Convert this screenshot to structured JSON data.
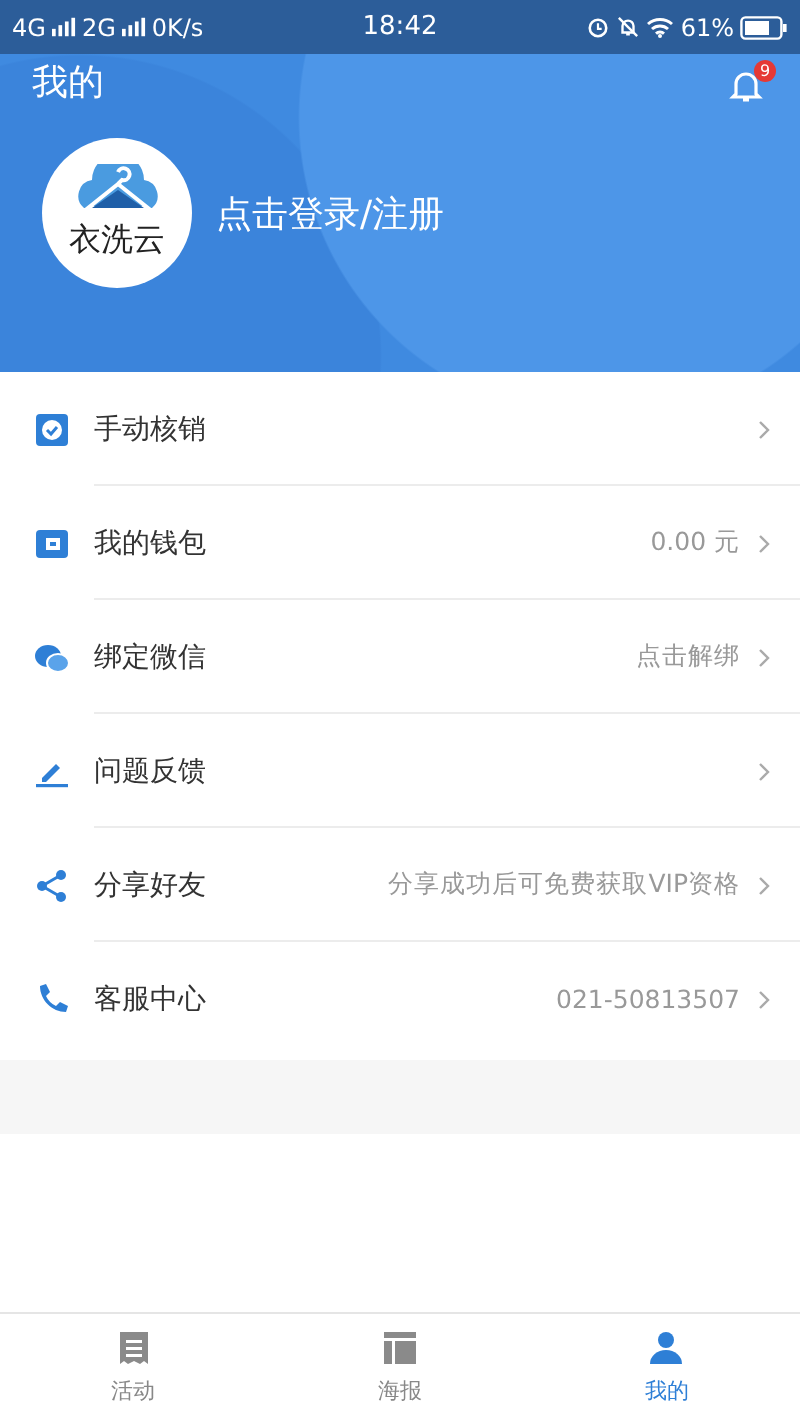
{
  "status_bar": {
    "network_1": "4G",
    "network_2": "2G",
    "speed": "0K/s",
    "time": "18:42",
    "battery": "61%"
  },
  "header": {
    "title": "我的",
    "notification_count": "9",
    "logo_text": "衣洗云",
    "login_label": "点击登录/注册"
  },
  "menu": [
    {
      "kind": "verify",
      "label": "手动核销"
    },
    {
      "kind": "wallet",
      "label": "我的钱包",
      "value": "0.00 元"
    },
    {
      "kind": "wechat",
      "label": "绑定微信",
      "value": "点击解绑"
    },
    {
      "kind": "feedback",
      "label": "问题反馈"
    },
    {
      "kind": "share",
      "label": "分享好友",
      "value": "分享成功后可免费获取VIP资格"
    },
    {
      "kind": "phone",
      "label": "客服中心",
      "value": "021-50813507"
    }
  ],
  "tabs": [
    {
      "kind": "activity",
      "label": "活动",
      "selected": false
    },
    {
      "kind": "poster",
      "label": "海报",
      "selected": false
    },
    {
      "kind": "me",
      "label": "我的",
      "selected": true
    }
  ]
}
